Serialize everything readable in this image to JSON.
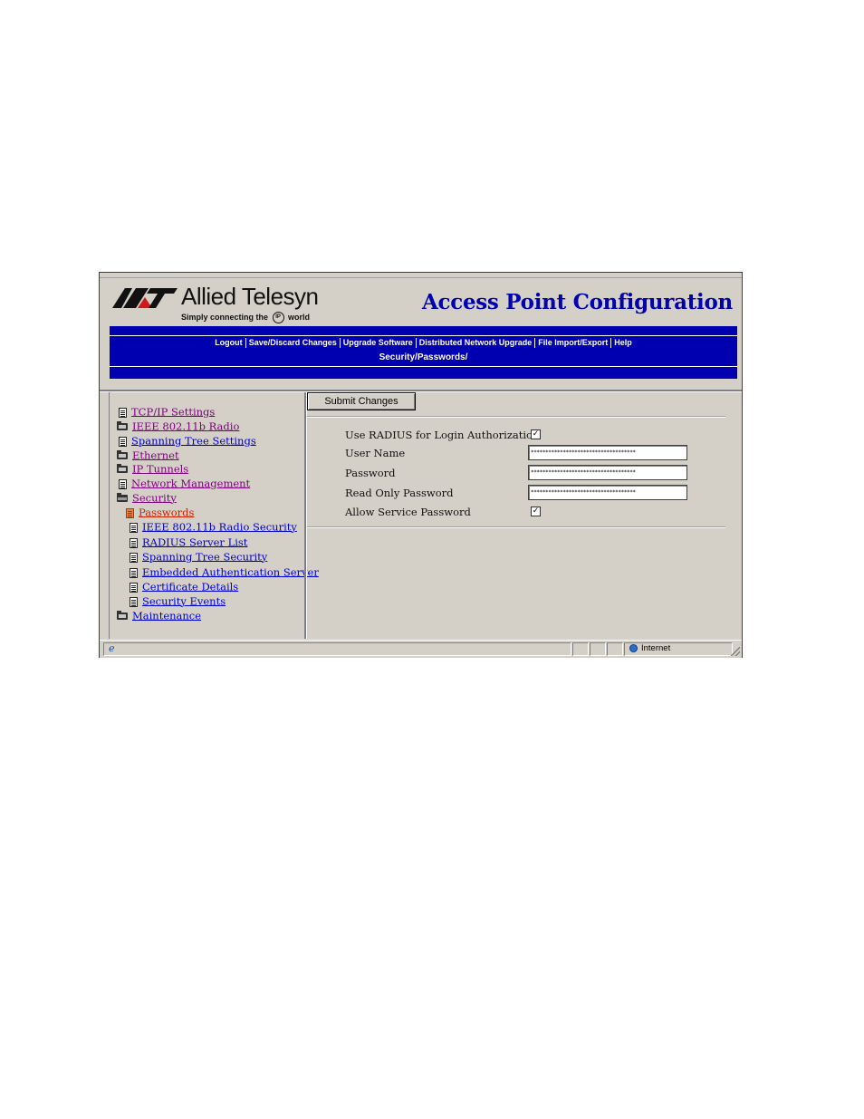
{
  "header": {
    "brand_name": "Allied Telesyn",
    "tagline_pre": "Simply connecting the",
    "tagline_ip": "IP",
    "tagline_post": "world",
    "app_title": "Access Point Configuration"
  },
  "nav": {
    "items": [
      "Logout",
      "Save/Discard Changes",
      "Upgrade Software",
      "Distributed Network Upgrade",
      "File Import/Export",
      "Help"
    ],
    "current_path": "Security/Passwords/"
  },
  "sidebar": {
    "items": [
      {
        "label": "TCP/IP Settings",
        "icon": "page-icon",
        "state": "visited"
      },
      {
        "label": "IEEE 802.11b Radio",
        "icon": "folder-icon",
        "state": "visited"
      },
      {
        "label": "Spanning Tree Settings",
        "icon": "page-icon",
        "state": "link"
      },
      {
        "label": "Ethernet",
        "icon": "folder-icon",
        "state": "visited"
      },
      {
        "label": "IP Tunnels",
        "icon": "folder-icon",
        "state": "visited"
      },
      {
        "label": "Network Management",
        "icon": "page-icon",
        "state": "visited"
      },
      {
        "label": "Security",
        "icon": "open-folder-icon",
        "state": "visited"
      },
      {
        "label": "Passwords",
        "icon": "page-icon-selected",
        "state": "current"
      },
      {
        "label": "IEEE 802.11b Radio Security",
        "icon": "page-icon",
        "state": "link"
      },
      {
        "label": "RADIUS Server List",
        "icon": "page-icon",
        "state": "link"
      },
      {
        "label": "Spanning Tree Security",
        "icon": "page-icon",
        "state": "link"
      },
      {
        "label": "Embedded Authentication Server",
        "icon": "page-icon",
        "state": "link"
      },
      {
        "label": "Certificate Details",
        "icon": "page-icon",
        "state": "link"
      },
      {
        "label": "Security Events",
        "icon": "page-icon",
        "state": "link"
      },
      {
        "label": "Maintenance",
        "icon": "folder-icon",
        "state": "link"
      }
    ]
  },
  "form": {
    "submit_label": "Submit Changes",
    "use_radius_label": "Use RADIUS for Login Authorization",
    "use_radius_checked": true,
    "user_name_label": "User Name",
    "user_name_value": "************************************",
    "password_label": "Password",
    "password_value": "************************************",
    "read_only_password_label": "Read Only Password",
    "read_only_password_value": "************************************",
    "allow_service_password_label": "Allow Service Password",
    "allow_service_password_checked": true,
    "check_mark": "✓"
  },
  "statusbar": {
    "zone_label": "Internet"
  },
  "colors": {
    "nav_bar": "#0000b0",
    "title": "#0000b0",
    "link": "#0000cc",
    "visited_link": "#800080",
    "current_link": "#cc2200",
    "window_chrome": "#d4d0c8"
  }
}
